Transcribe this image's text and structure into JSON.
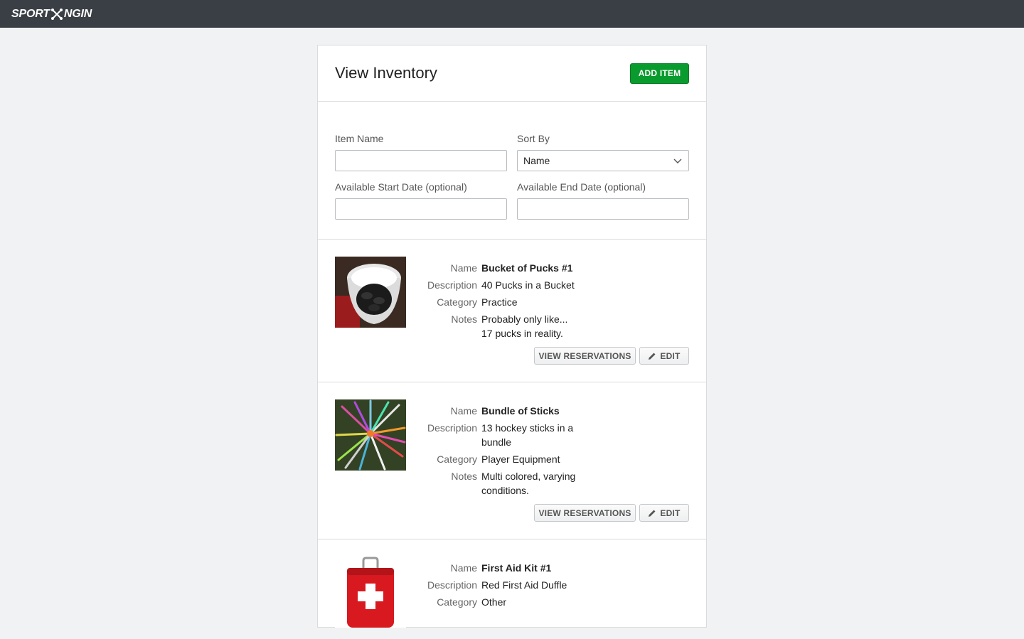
{
  "brand": {
    "logo_left": "SPORT",
    "logo_right": "NGIN"
  },
  "page": {
    "title": "View Inventory",
    "add_button": "ADD ITEM"
  },
  "filters": {
    "item_name_label": "Item Name",
    "item_name_value": "",
    "sort_by_label": "Sort By",
    "sort_by_value": "Name",
    "start_date_label": "Available Start Date (optional)",
    "start_date_value": "",
    "end_date_label": "Available End Date (optional)",
    "end_date_value": ""
  },
  "labels": {
    "name": "Name",
    "description": "Description",
    "category": "Category",
    "notes": "Notes"
  },
  "buttons": {
    "view_reservations": "VIEW RESERVATIONS",
    "edit": "EDIT"
  },
  "items": [
    {
      "name": "Bucket of Pucks #1",
      "description": "40 Pucks in a Bucket",
      "category": "Practice",
      "notes": "Probably only like... 17 pucks in reality.",
      "image_icon": "bucket-of-pucks-image"
    },
    {
      "name": "Bundle of Sticks",
      "description": "13 hockey sticks in a bundle",
      "category": "Player Equipment",
      "notes": "Multi colored, varying conditions.",
      "image_icon": "hockey-sticks-image"
    },
    {
      "name": "First Aid Kit #1",
      "description": "Red First Aid Duffle",
      "category": "Other",
      "notes": "",
      "image_icon": "first-aid-kit-image"
    }
  ],
  "colors": {
    "topbar": "#3a3f45",
    "add_button": "#0a9b2e",
    "background": "#f1f2f3"
  }
}
